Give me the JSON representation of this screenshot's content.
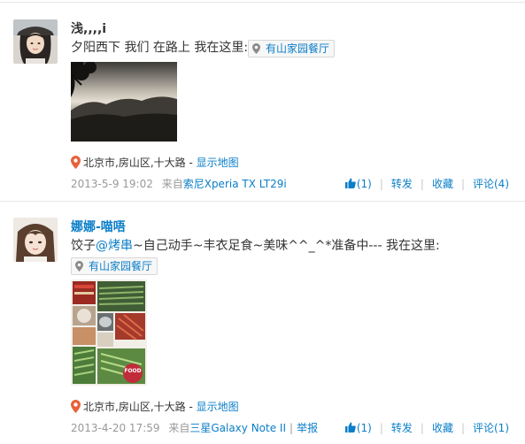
{
  "posts": [
    {
      "username": "浅,,,,i",
      "text": "夕阳西下 我们 在路上 我在这里:",
      "location_tag": "有山家园餐厅",
      "geo": {
        "address": "北京市,房山区,十大路 - ",
        "map_link": "显示地图"
      },
      "meta": {
        "date": "2013-5-9 19:02",
        "from_label": "来自",
        "source": "索尼Xperia TX LT29i"
      },
      "actions": {
        "like": "(1)",
        "repost": "转发",
        "favorite": "收藏",
        "comment": "评论(4)"
      }
    },
    {
      "username": "娜娜-喵唔",
      "text_before": "饺子",
      "mention": "@烤串",
      "text_after": "~自己动手~丰衣足食~美味^^_^*准备中--- 我在这里:",
      "location_tag": "有山家园餐厅",
      "photo_caption": "FOOD",
      "geo": {
        "address": "北京市,房山区,十大路 - ",
        "map_link": "显示地图"
      },
      "meta": {
        "date": "2013-4-20 17:59",
        "from_label": "来自",
        "source": "三星Galaxy Note II",
        "report": "举报"
      },
      "actions": {
        "like": "(1)",
        "repost": "转发",
        "favorite": "收藏",
        "comment": "评论(1)"
      }
    }
  ],
  "colors": {
    "link": "#0a7ec8",
    "meta_gray": "#999999",
    "pin_orange": "#e8613c"
  },
  "icons": [
    "location-pin-icon",
    "thumbs-up-icon"
  ]
}
